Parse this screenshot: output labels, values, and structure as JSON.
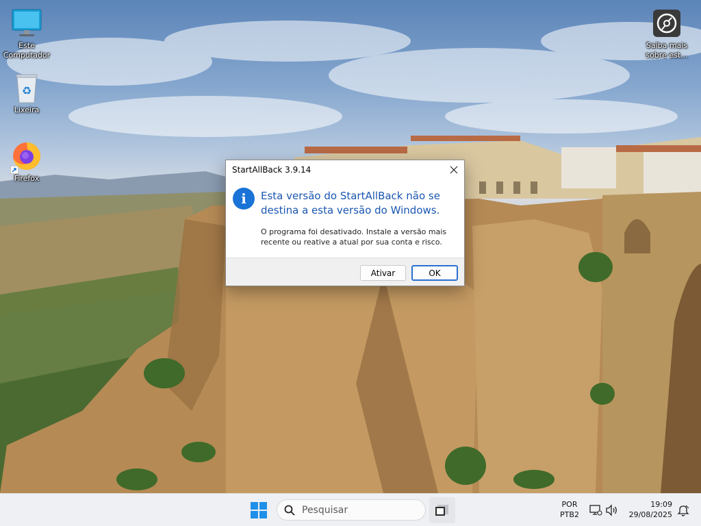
{
  "desktop": {
    "icons": [
      {
        "label": "Este Computador",
        "icon": "monitor-icon"
      },
      {
        "label": "Lixeira",
        "icon": "recycle-bin-icon"
      },
      {
        "label": "Firefox",
        "icon": "firefox-icon"
      },
      {
        "label": "Saiba mais sobre est...",
        "icon": "learn-more-icon"
      }
    ]
  },
  "dialog": {
    "title": "StartAllBack 3.9.14",
    "icon": "info-icon",
    "main_instruction": "Esta versão do StartAllBack não se destina a esta versão do Windows.",
    "content": "O programa foi desativado. Instale a versão mais recente ou reative a atual por sua conta e risco.",
    "buttons": {
      "activate": "Ativar",
      "ok": "OK"
    }
  },
  "taskbar": {
    "search_placeholder": "Pesquisar",
    "language": {
      "line1": "POR",
      "line2": "PTB2"
    },
    "clock": {
      "time": "19:09",
      "date": "29/08/2025"
    }
  },
  "colors": {
    "accent": "#1a73d6",
    "dialog_heading": "#1a56b0",
    "taskbar": "#eef0f3"
  }
}
